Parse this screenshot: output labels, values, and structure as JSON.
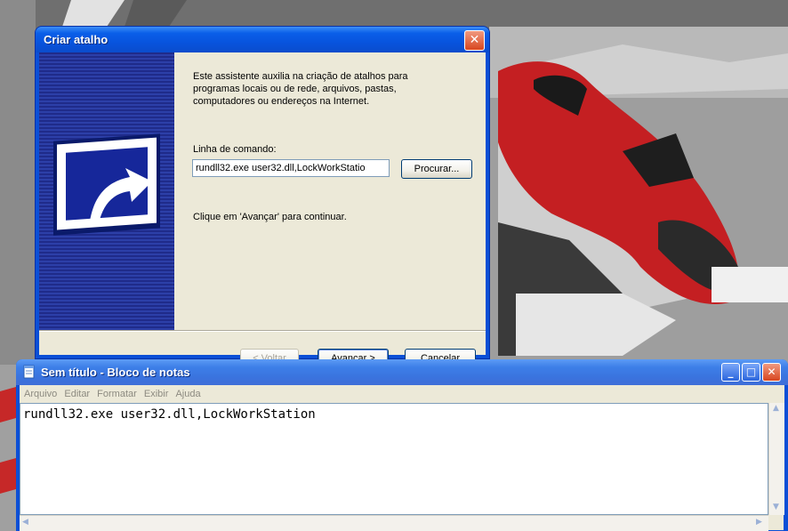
{
  "wizard": {
    "title": "Criar atalho",
    "description": "Este assistente auxilia na criação de atalhos para programas locais ou de rede, arquivos, pastas, computadores ou endereços na Internet.",
    "command_label": "Linha de comando:",
    "command_value": "rundll32.exe user32.dll,LockWorkStatio",
    "browse_label": "Procurar...",
    "continue_text": "Clique em 'Avançar' para continuar.",
    "back_label": "< Voltar",
    "next_label": "Avançar >",
    "cancel_label": "Cancelar",
    "close_symbol": "✕"
  },
  "notepad": {
    "title": "Sem título - Bloco de notas",
    "menu": [
      "Arquivo",
      "Editar",
      "Formatar",
      "Exibir",
      "Ajuda"
    ],
    "content": "rundll32.exe user32.dll,LockWorkStation",
    "minimize_symbol": "_",
    "maximize_symbol": "□",
    "close_symbol": "✕"
  },
  "colors": {
    "xp_blue": "#0b4fd6",
    "dialog_face": "#ece9d8",
    "close_red": "#d8461f"
  }
}
